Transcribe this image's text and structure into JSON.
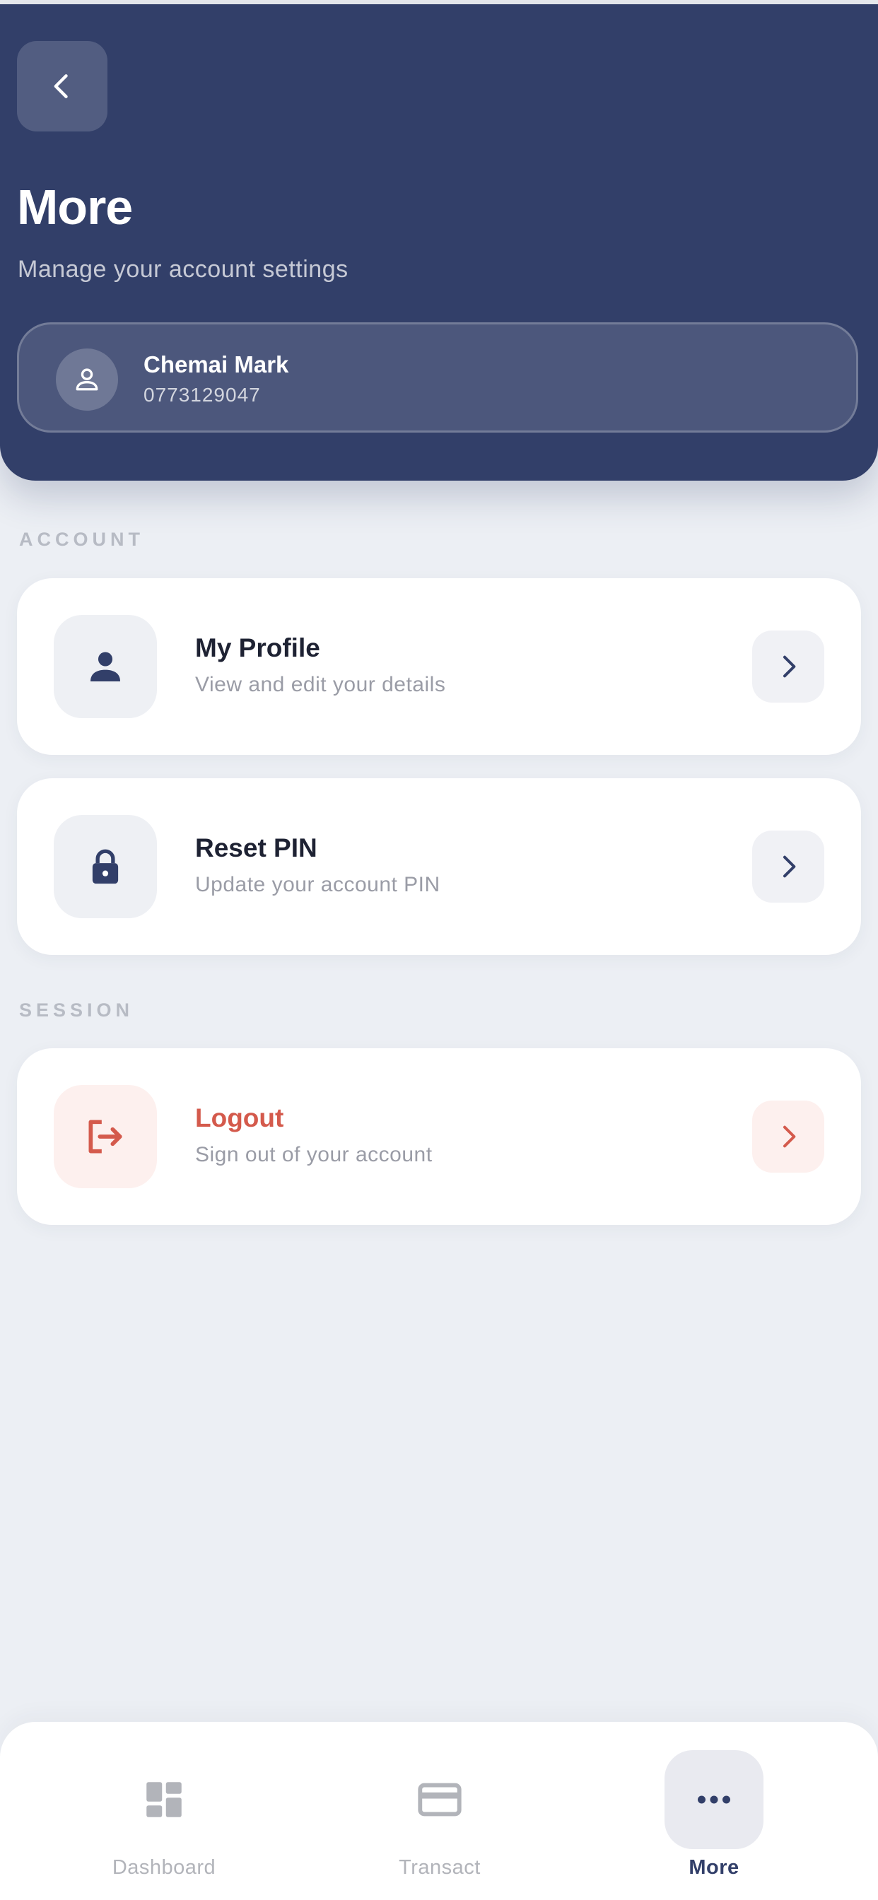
{
  "header": {
    "title": "More",
    "subtitle": "Manage your account settings"
  },
  "user": {
    "name": "Chemai Mark",
    "phone": "0773129047"
  },
  "sections": {
    "account_label": "ACCOUNT",
    "session_label": "SESSION"
  },
  "items": {
    "profile": {
      "title": "My Profile",
      "subtitle": "View and edit your details",
      "icon": "person-icon"
    },
    "reset_pin": {
      "title": "Reset PIN",
      "subtitle": "Update your account PIN",
      "icon": "lock-icon"
    },
    "logout": {
      "title": "Logout",
      "subtitle": "Sign out of your account",
      "icon": "logout-icon"
    }
  },
  "nav": {
    "dashboard": "Dashboard",
    "transact": "Transact",
    "more": "More",
    "active": "More"
  },
  "colors": {
    "primary": "#323f69",
    "danger": "#d45a4c",
    "background": "#eceff4"
  }
}
